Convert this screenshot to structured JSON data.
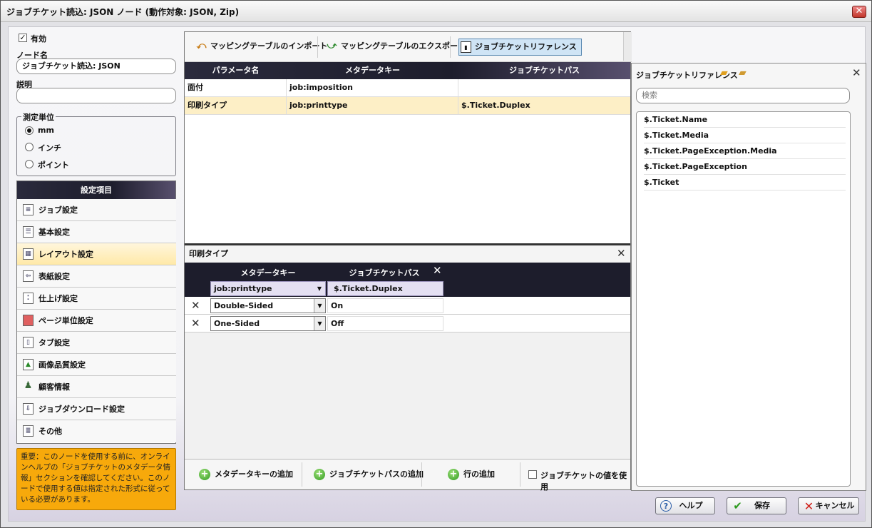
{
  "window": {
    "title": "ジョブチケット読込: JSON ノード (動作対象: JSON, Zip)",
    "close": "✕"
  },
  "left": {
    "enabled_label": "有効",
    "node_name_label": "ノード名",
    "node_name_value": "ジョブチケット読込: JSON",
    "description_label": "説明",
    "description_value": "",
    "units_legend": "測定単位",
    "units": [
      {
        "label": "mm",
        "selected": true
      },
      {
        "label": "インチ",
        "selected": false
      },
      {
        "label": "ポイント",
        "selected": false
      }
    ],
    "settings_header": "設定項目",
    "nav": [
      {
        "label": "ジョブ設定",
        "icon": "document-icon"
      },
      {
        "label": "基本設定",
        "icon": "list-icon"
      },
      {
        "label": "レイアウト設定",
        "icon": "layout-icon"
      },
      {
        "label": "表紙設定",
        "icon": "cover-icon"
      },
      {
        "label": "仕上げ設定",
        "icon": "finishing-icon"
      },
      {
        "label": "ページ単位設定",
        "icon": "page-icon"
      },
      {
        "label": "タブ設定",
        "icon": "tab-icon"
      },
      {
        "label": "画像品質設定",
        "icon": "image-icon"
      },
      {
        "label": "顧客情報",
        "icon": "customer-icon"
      },
      {
        "label": "ジョブダウンロード設定",
        "icon": "download-icon"
      },
      {
        "label": "その他",
        "icon": "other-icon"
      }
    ],
    "selected_nav": 2,
    "note": "重要：このノードを使用する前に、オンラインヘルプの「ジョブチケットのメタデータ情報」セクションを確認してください。このノードで使用する値は指定された形式に従っている必要があります。"
  },
  "toolbar": {
    "import": "マッピングテーブルのインポート",
    "export": "マッピングテーブルのエクスポート",
    "reference": "ジョブチケットリファレンス"
  },
  "grid": {
    "headers": [
      "パラメータ名",
      "メタデータキー",
      "ジョブチケットパス"
    ],
    "rows": [
      {
        "param": "面付",
        "key": "job:imposition",
        "path": ""
      },
      {
        "param": "印刷タイプ",
        "key": "job:printtype",
        "path": "$.Ticket.Duplex"
      }
    ]
  },
  "detail": {
    "title": "印刷タイプ",
    "col_key": "メタデータキー",
    "col_path": "ジョブチケットパス",
    "key_select": "job:printtype",
    "path_value": "$.Ticket.Duplex",
    "rows": [
      {
        "key": "Double-Sided",
        "value": "On"
      },
      {
        "key": "One-Sided",
        "value": "Off"
      }
    ]
  },
  "footer": {
    "add_key": "メタデータキーの追加",
    "add_path": "ジョブチケットパスの追加",
    "add_row": "行の追加",
    "use_value": "ジョブチケットの値を使用"
  },
  "reference": {
    "title": "ジョブチケットリファレンス",
    "search_placeholder": "検索",
    "items": [
      "$.Ticket.Name",
      "$.Ticket.Media",
      "$.Ticket.PageException.Media",
      "$.Ticket.PageException",
      "$.Ticket"
    ]
  },
  "buttons": {
    "help": "ヘルプ",
    "save": "保存",
    "cancel": "キャンセル"
  },
  "colors": {
    "selected_row": "#fdefc6",
    "note_bg": "#f7a90b",
    "header_dark": "#1d1d2c",
    "save_check": "#2d9a1e",
    "cancel_x": "#d0211a"
  }
}
